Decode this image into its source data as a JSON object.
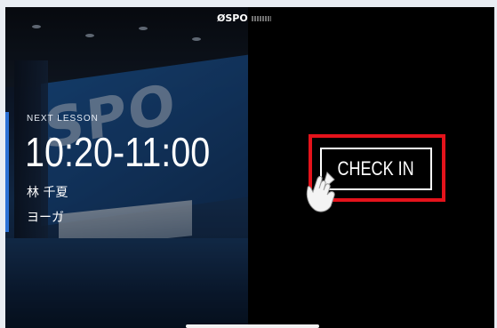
{
  "left_panel": {
    "next_lesson_label": "NEXT LESSON",
    "time": "10:20-11:00",
    "instructor": "林 千夏",
    "lesson_name": "ヨーガ",
    "background_logo_text": "SPO"
  },
  "header": {
    "brand_logo": "ØSPO"
  },
  "main": {
    "checkin_label": "CHECK IN",
    "highlight_color": "#e4131b"
  },
  "icons": {
    "pointer": "pointing-hand-icon"
  },
  "colors": {
    "accent": "#2d72d6",
    "background": "#000000",
    "text": "#ffffff"
  }
}
